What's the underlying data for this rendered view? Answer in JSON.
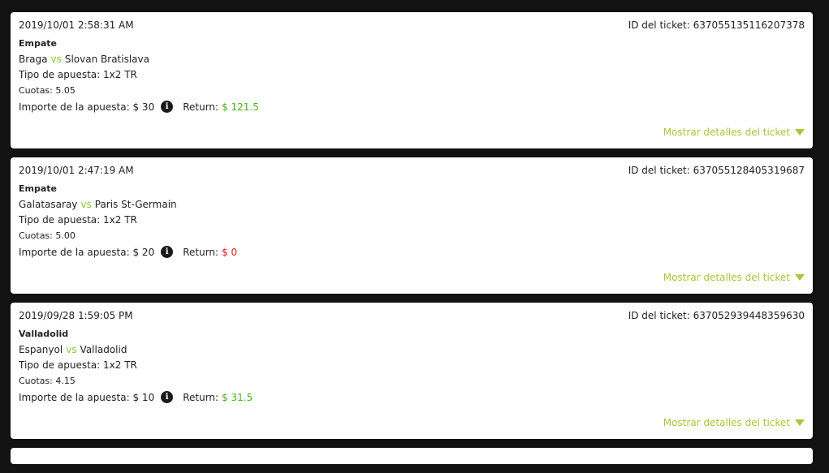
{
  "labels": {
    "ticket_id_prefix": "ID del ticket:",
    "bet_type_prefix": "Tipo de apuesta:",
    "odds_prefix": "Cuotas:",
    "amount_prefix": "Importe de la apuesta:",
    "return_prefix": "Return:",
    "vs": "vs",
    "show_details": "Mostrar detalles del ticket"
  },
  "colors": {
    "background": "#121212",
    "accent": "#a5c83c",
    "win": "#4caf1e",
    "loss": "#e21b1b"
  },
  "tickets": [
    {
      "datetime": "2019/10/01 2:58:31 AM",
      "ticket_id": "637055135116207378",
      "selection": "Empate",
      "home": "Braga",
      "away": "Slovan Bratislava",
      "bet_type": "1x2 TR",
      "odds": "5.05",
      "amount": "$ 30",
      "return": "$ 121.5",
      "status": "win"
    },
    {
      "datetime": "2019/10/01 2:47:19 AM",
      "ticket_id": "637055128405319687",
      "selection": "Empate",
      "home": "Galatasaray",
      "away": "Paris St-Germain",
      "bet_type": "1x2 TR",
      "odds": "5.00",
      "amount": "$ 20",
      "return": "$ 0",
      "status": "loss"
    },
    {
      "datetime": "2019/09/28 1:59:05 PM",
      "ticket_id": "637052939448359630",
      "selection": "Valladolid",
      "home": "Espanyol",
      "away": "Valladolid",
      "bet_type": "1x2 TR",
      "odds": "4.15",
      "amount": "$ 10",
      "return": "$ 31.5",
      "status": "win"
    }
  ]
}
